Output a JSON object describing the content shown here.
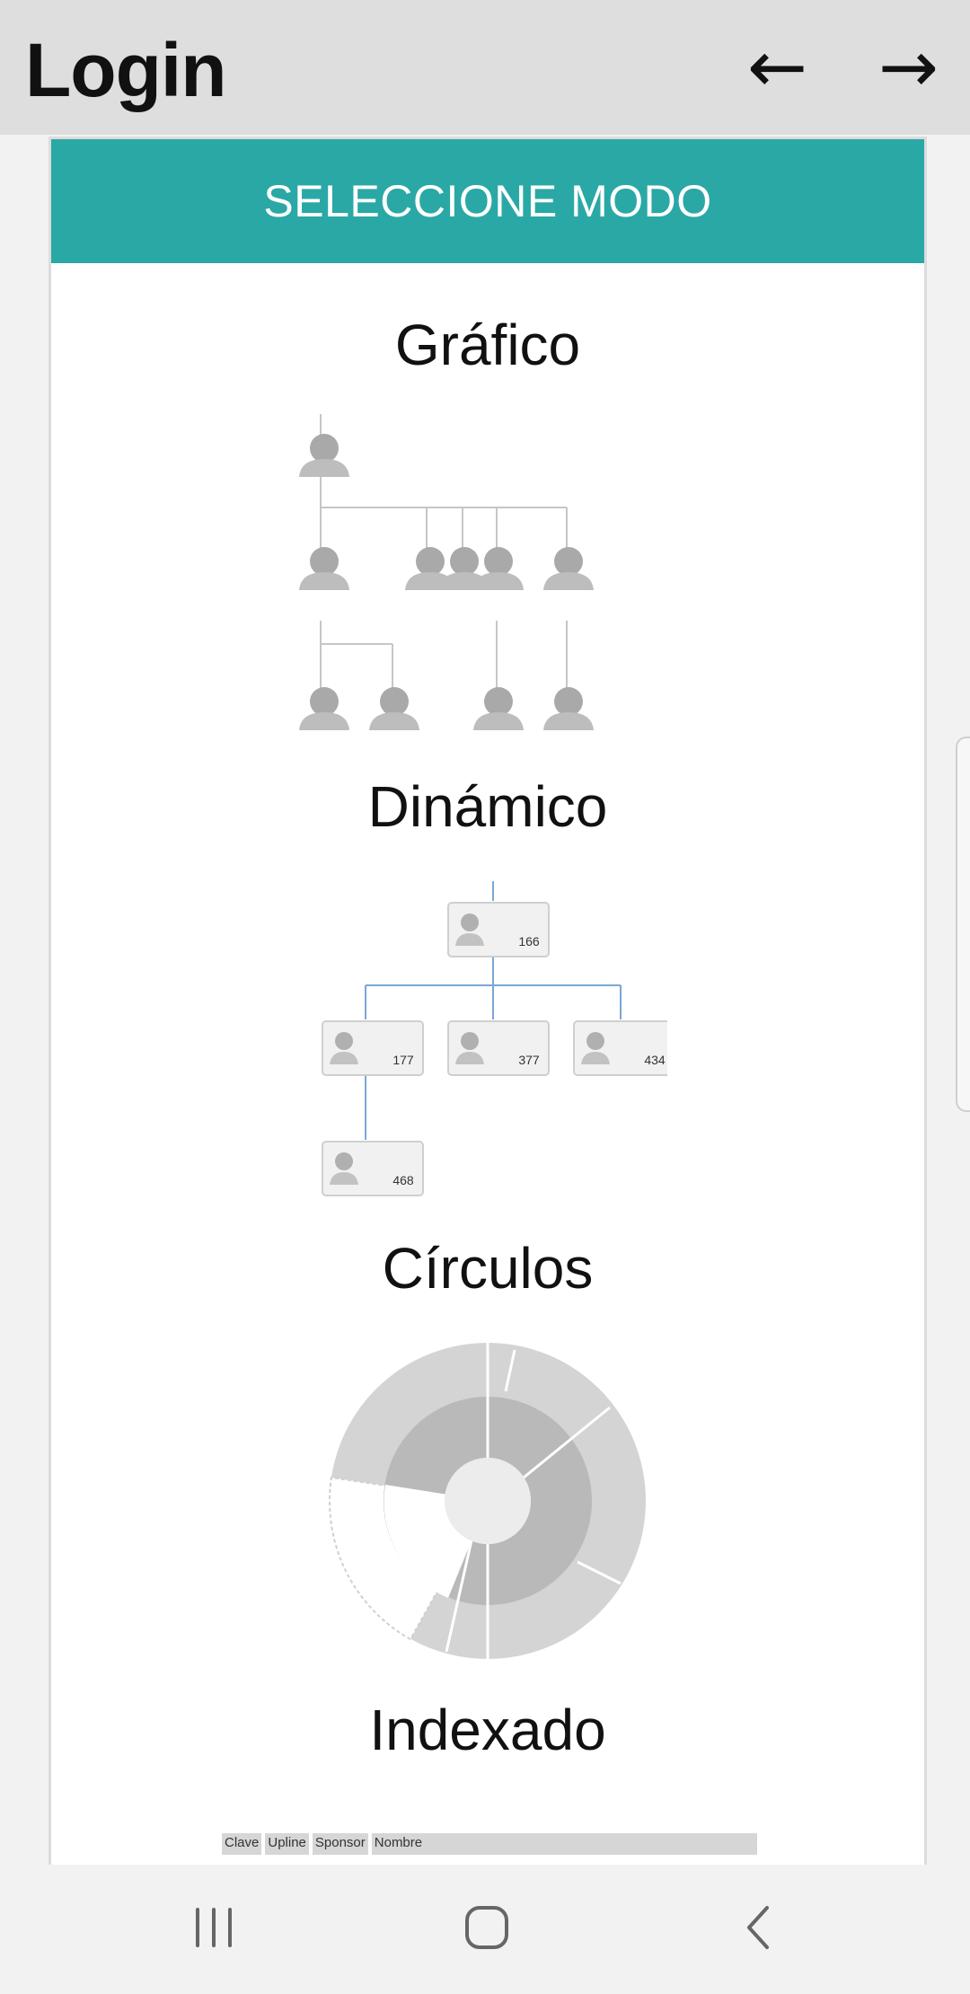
{
  "header": {
    "title": "Login"
  },
  "card": {
    "header_label": "SELECCIONE MODO",
    "modes": [
      {
        "label": "Gráfico"
      },
      {
        "label": "Dinámico",
        "node_values": [
          "166",
          "177",
          "377",
          "434",
          "468"
        ]
      },
      {
        "label": "Círculos"
      },
      {
        "label": "Indexado",
        "table_headers": [
          "Clave",
          "Upline",
          "Sponsor",
          "Nombre"
        ]
      }
    ]
  },
  "colors": {
    "accent": "#2aa8a6",
    "link_line": "#7aa7d6"
  }
}
